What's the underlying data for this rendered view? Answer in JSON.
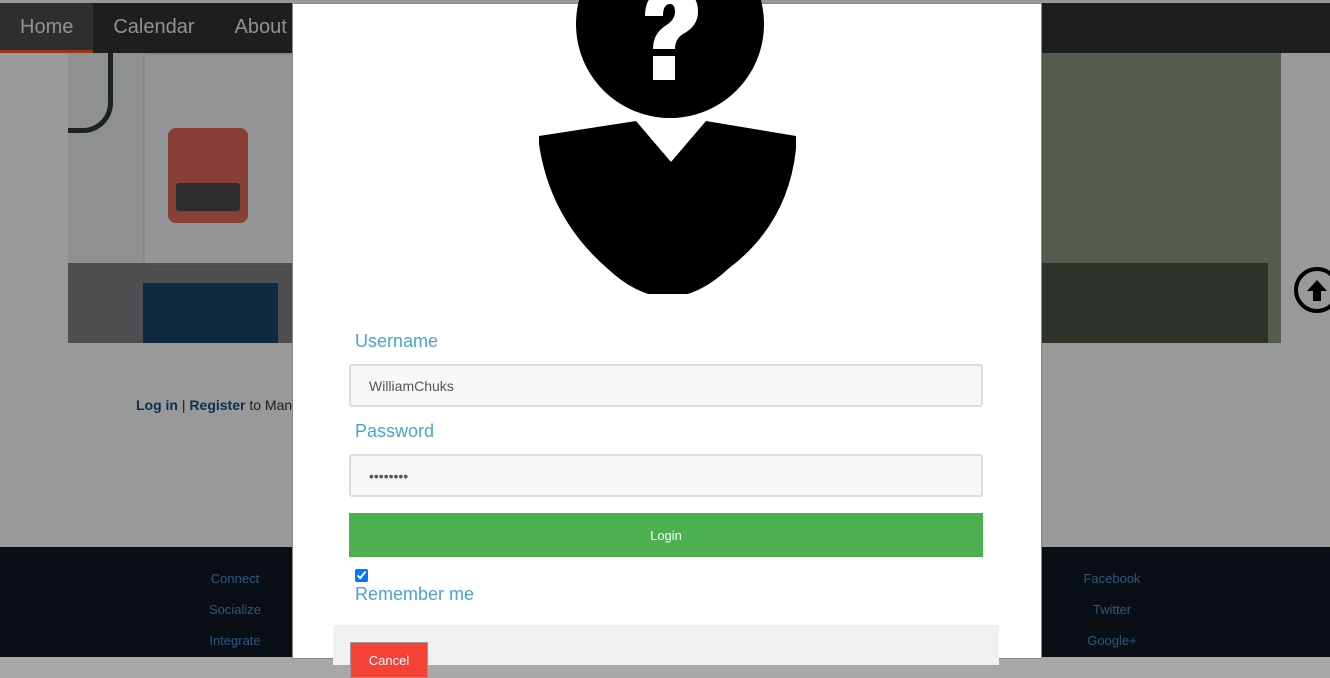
{
  "nav": {
    "items": [
      {
        "label": "Home",
        "active": true
      },
      {
        "label": "Calendar",
        "active": false
      },
      {
        "label": "About",
        "active": false
      }
    ]
  },
  "auth": {
    "login_link": "Log in",
    "separator": "|",
    "register_link": "Register",
    "suffix": "to Manag"
  },
  "footer": {
    "left_links": [
      "Connect",
      "Socialize",
      "Integrate"
    ],
    "right_links": [
      "Facebook",
      "Twitter",
      "Google+"
    ]
  },
  "login_form": {
    "username_label": "Username",
    "username_value": "WilliamChuks",
    "password_label": "Password",
    "password_value": "password",
    "login_button": "Login",
    "remember_label": "Remember me",
    "remember_checked": true,
    "cancel_button": "Cancel"
  },
  "colors": {
    "accent_blue": "#4aa3d1",
    "login_green": "#4caf50",
    "cancel_red": "#f44336",
    "nav_bg": "#333333",
    "nav_active_underline": "#ff5722"
  },
  "icons": {
    "avatar": "unknown-user-icon",
    "scroll_top": "arrow-up-circle-icon"
  }
}
